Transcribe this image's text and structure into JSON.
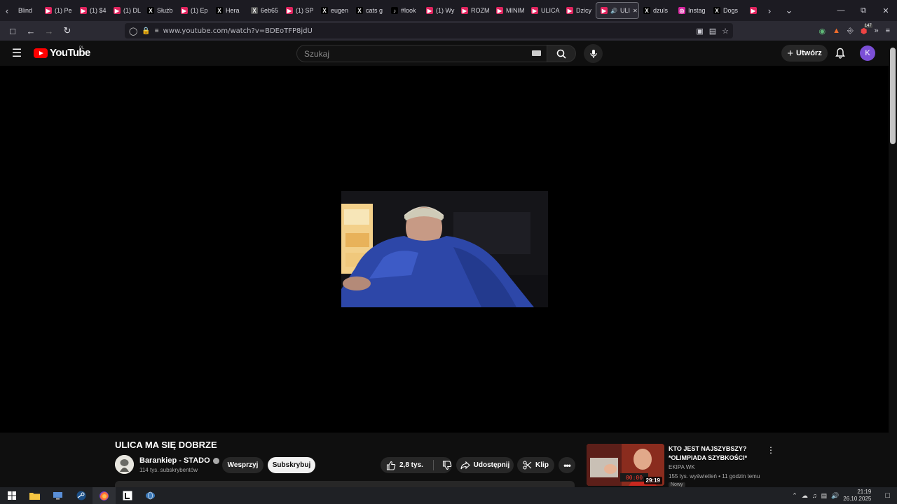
{
  "browser": {
    "tabs": [
      {
        "label": "Blind",
        "icon": "generic-icon",
        "color": "#3a3a40"
      },
      {
        "label": "(1) Pe",
        "icon": "youtube-icon",
        "color": "#e0245e"
      },
      {
        "label": "(1) $4",
        "icon": "youtube-icon",
        "color": "#e0245e"
      },
      {
        "label": "(1) DL",
        "icon": "youtube-icon",
        "color": "#e0245e"
      },
      {
        "label": "Służb",
        "icon": "x-icon",
        "color": "#000000"
      },
      {
        "label": "(1) Ep",
        "icon": "youtube-icon",
        "color": "#e0245e"
      },
      {
        "label": "Hera",
        "icon": "x-icon",
        "color": "#000000"
      },
      {
        "label": "6eb65",
        "icon": "x-box-icon",
        "color": "#555555"
      },
      {
        "label": "(1) SP",
        "icon": "youtube-icon",
        "color": "#e0245e"
      },
      {
        "label": "eugen",
        "icon": "x-icon",
        "color": "#000000"
      },
      {
        "label": "cats g",
        "icon": "x-icon",
        "color": "#000000"
      },
      {
        "label": "#look",
        "icon": "tiktok-icon",
        "color": "#000000"
      },
      {
        "label": "(1) Wy",
        "icon": "youtube-icon",
        "color": "#e0245e"
      },
      {
        "label": "ROZM",
        "icon": "youtube-icon",
        "color": "#e0245e"
      },
      {
        "label": "MINIM",
        "icon": "youtube-icon",
        "color": "#e0245e"
      },
      {
        "label": "ULICA",
        "icon": "youtube-icon",
        "color": "#e0245e"
      },
      {
        "label": "Dzicy",
        "icon": "youtube-icon",
        "color": "#e0245e"
      },
      {
        "label": "ULI",
        "icon": "youtube-icon",
        "color": "#e0245e",
        "active": true
      },
      {
        "label": "dzuls",
        "icon": "x-icon",
        "color": "#000000"
      },
      {
        "label": "Instag",
        "icon": "instagram-icon",
        "color": "#d6249f"
      },
      {
        "label": "Dogs",
        "icon": "x-icon",
        "color": "#000000"
      },
      {
        "label": "",
        "icon": "youtube-icon",
        "color": "#e0245e"
      }
    ],
    "url": "www.youtube.com/watch?v=BDEoTFP8jdU",
    "extension_badge": "147"
  },
  "youtube": {
    "logo_text": "YouTube",
    "region": "PL",
    "search_placeholder": "Szukaj",
    "create_label": "Utwórz",
    "avatar_letter": "K"
  },
  "video": {
    "title": "ULICA MA SIĘ DOBRZE",
    "channel": "Barankiep - STADO",
    "subscribers": "114 tys. subskrybentów",
    "support_label": "Wesprzyj",
    "subscribe_label": "Subskrybuj",
    "likes": "2,8 tys.",
    "share_label": "Udostępnij",
    "clip_label": "Klip"
  },
  "recommended": {
    "title": "KTO JEST NAJSZYBSZY? *OLIMPIADA SZYBKOŚCI*",
    "channel": "EKIPA WK",
    "views": "155 tys. wyświetleń",
    "age": "11 godzin temu",
    "duration": "29:19",
    "thumb_timer": "00:00",
    "badge": "Nowy"
  },
  "taskbar": {
    "time": "21:19",
    "date": "26.10.2025"
  },
  "colors": {
    "accent_red": "#ff0000",
    "avatar_bg": "#7b4fd6"
  }
}
